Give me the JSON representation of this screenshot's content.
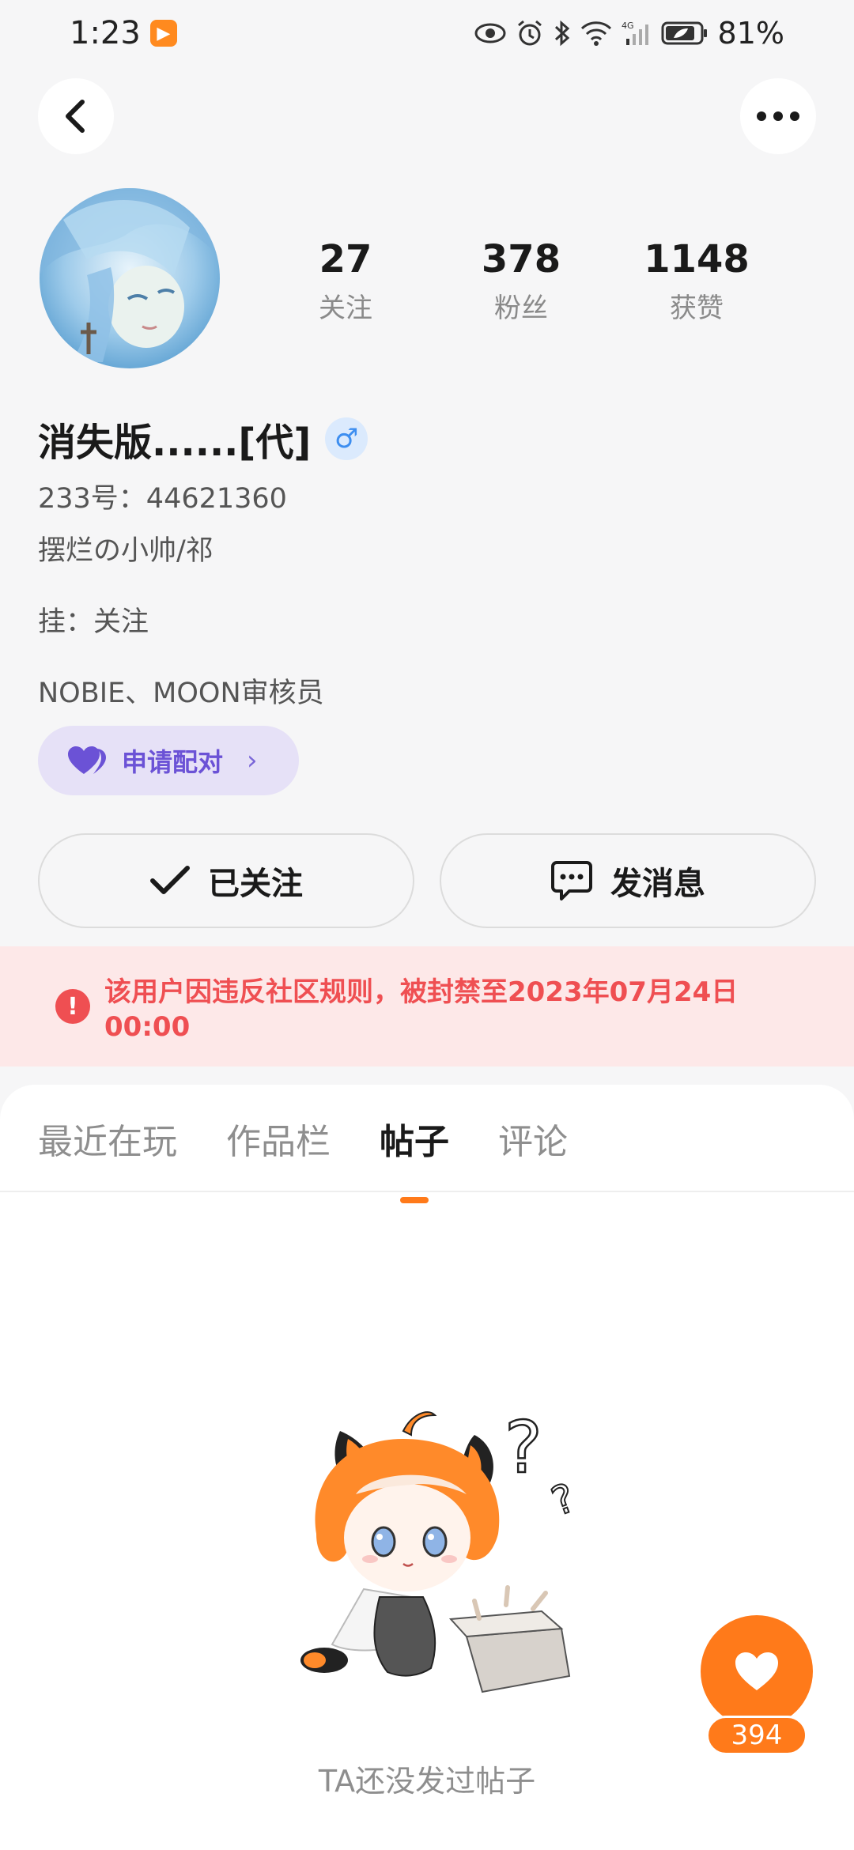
{
  "status_bar": {
    "time": "1:23",
    "battery": "81%",
    "network": "4G"
  },
  "profile": {
    "username": "消失版......[代]",
    "gender_symbol": "♂",
    "id_line": "233号：44621360",
    "bio_lines": [
      "摆烂の小帅/祁",
      "挂：关注",
      "NOBIE、MOON审核员"
    ],
    "stats": [
      {
        "value": "27",
        "label": "关注"
      },
      {
        "value": "378",
        "label": "粉丝"
      },
      {
        "value": "1148",
        "label": "获赞"
      }
    ]
  },
  "actions": {
    "pair_label": "申请配对",
    "follow_label": "已关注",
    "message_label": "发消息"
  },
  "ban_notice": {
    "text": "该用户因违反社区规则，被封禁至2023年07月24日 00:00"
  },
  "tabs": [
    {
      "label": "最近在玩",
      "active": false
    },
    {
      "label": "作品栏",
      "active": false
    },
    {
      "label": "帖子",
      "active": true
    },
    {
      "label": "评论",
      "active": false
    }
  ],
  "empty_state": {
    "text": "TA还没发过帖子"
  },
  "like_fab": {
    "count": "394"
  },
  "colors": {
    "accent": "#ff7a1a",
    "ban_red": "#ef4f52",
    "pair_purple": "#6b52d6"
  }
}
